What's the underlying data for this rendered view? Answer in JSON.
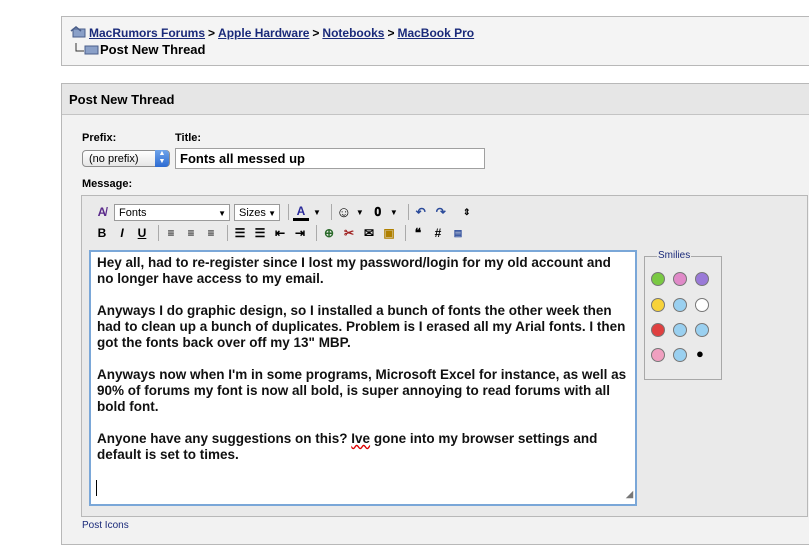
{
  "breadcrumb": {
    "items": [
      "MacRumors Forums",
      "Apple Hardware",
      "Notebooks",
      "MacBook Pro"
    ],
    "separator": ">",
    "current": "Post New Thread"
  },
  "panel": {
    "title": "Post New Thread",
    "prefix": {
      "label": "Prefix:",
      "value": "(no prefix)"
    },
    "title_field": {
      "label": "Title:",
      "value": "Fonts all messed up"
    },
    "message": {
      "label": "Message:",
      "paragraphs": [
        "Hey all, had to re-register since I lost my password/login for my old account and no longer have access to my email.",
        "Anyways I do graphic design, so I installed a bunch of fonts the other week then had to clean up a bunch of duplicates. Problem is I erased all my Arial fonts. I then got the fonts back over off my 13\" MBP.",
        "Anyways now when I'm in some programs, Microsoft Excel for instance, as well as 90% of forums my font is now all bold, is super annoying to read forums with all bold font.",
        "Anyone have any suggestions on this? Ive gone into my browser settings and default is set to times."
      ],
      "p4_before": "Anyone have any suggestions on this? ",
      "p4_misspelled": "Ive",
      "p4_after": " gone into my browser settings and default is set to times."
    },
    "toolbar": {
      "font_select": "Fonts",
      "size_select": "Sizes",
      "bold": "B",
      "italic": "I",
      "underline": "U",
      "hash": "#"
    },
    "smilies": {
      "legend": "Smilies",
      "icons": [
        "grin-icon",
        "tongue-icon",
        "purple-face-icon",
        "smile-icon",
        "confused-icon",
        "shocked-icon",
        "mad-icon",
        "rolleyes-icon",
        "cool-icon",
        "wink-icon",
        "happy-icon",
        "apple-icon"
      ]
    },
    "post_icons_legend": "Post Icons"
  }
}
